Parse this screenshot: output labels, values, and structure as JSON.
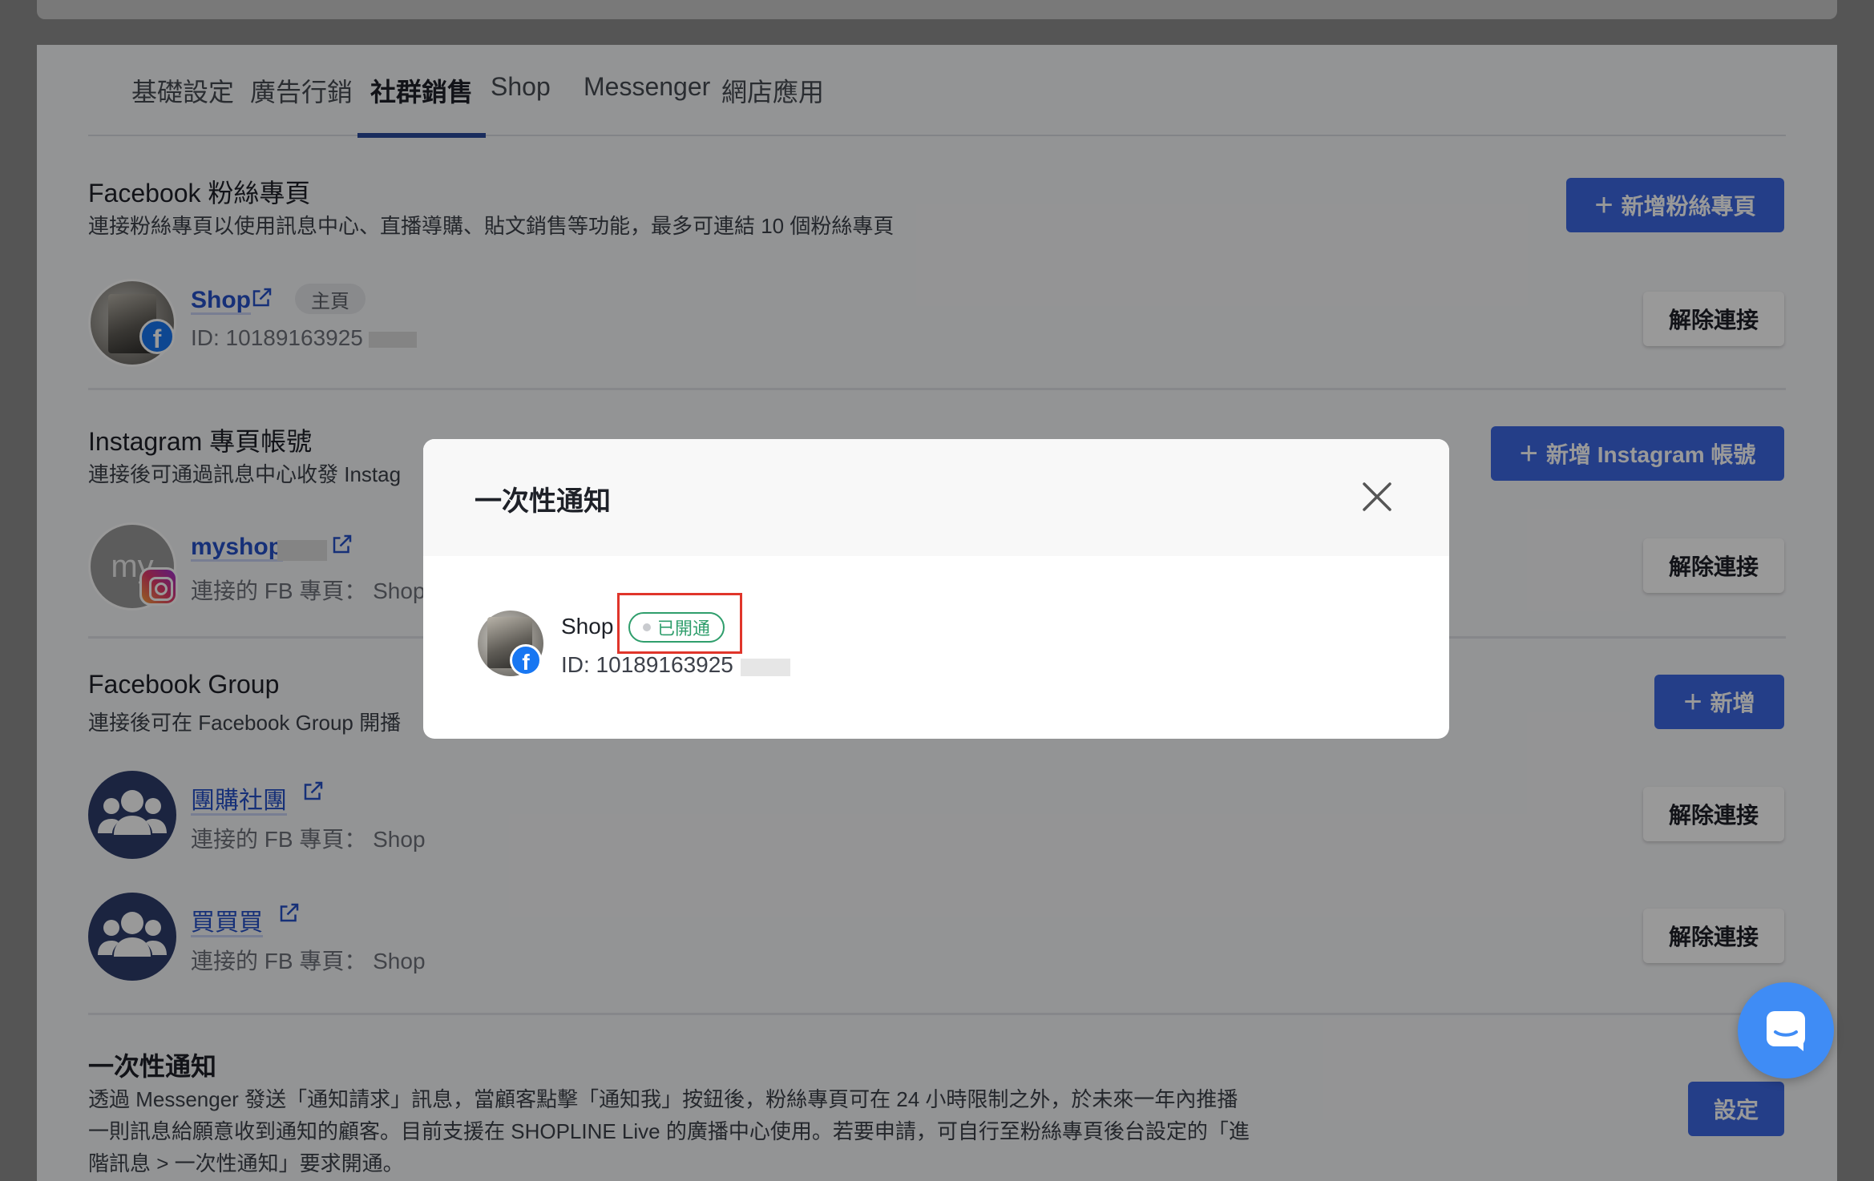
{
  "tabs": [
    "基礎設定",
    "廣告行銷",
    "社群銷售",
    "Shop",
    "Messenger",
    "網店應用"
  ],
  "facebook_pages": {
    "title": "Facebook 粉絲專頁",
    "desc": "連接粉絲專頁以使用訊息中心、直播導購、貼文銷售等功能，最多可連結 10 個粉絲專頁",
    "add_label": "新增粉絲專頁",
    "page_name": "Shop",
    "badge": "主頁",
    "id_text": "ID: 10189163925",
    "disconnect_label": "解除連接"
  },
  "instagram": {
    "title": "Instagram 專頁帳號",
    "desc": "連接後可通過訊息中心收發 Instag",
    "add_label": "新增 Instagram 帳號",
    "avatar_text": "my",
    "account_name": "myshop",
    "linked_text": "連接的 FB 專頁： Shop",
    "disconnect_label": "解除連接"
  },
  "facebook_group": {
    "title": "Facebook Group",
    "desc": "連接後可在 Facebook Group 開播",
    "add_label": "新增",
    "groups": [
      {
        "name": "團購社團",
        "linked_text": "連接的 FB 專頁： Shop",
        "disconnect_label": "解除連接"
      },
      {
        "name": "買買買",
        "linked_text": "連接的 FB 專頁： Shop",
        "disconnect_label": "解除連接"
      }
    ]
  },
  "one_time_notification": {
    "title": "一次性通知",
    "desc_line1": "透過 Messenger 發送「通知請求」訊息，當顧客點擊「通知我」按鈕後，粉絲專頁可在 24 小時限制之外，於未來一年內推播",
    "desc_line2": "一則訊息給願意收到通知的顧客。目前支援在 SHOPLINE Live 的廣播中心使用。若要申請，可自行至粉絲專頁後台設定的「進",
    "desc_line3": "階訊息 > 一次性通知」要求開通。",
    "settings_label": "設定"
  },
  "modal": {
    "title": "一次性通知",
    "page_name": "Shop",
    "status": "已開通",
    "id_text": "ID: 10189163925"
  },
  "colors": {
    "primary": "#3c68e3",
    "link": "#2650c9",
    "tab_indicator": "#2b4a9c",
    "status_green": "#2f9e6c",
    "highlight_red": "#e0352b",
    "chat_blue": "#3f8cf5"
  },
  "icons": [
    "external-link-icon",
    "facebook-icon",
    "instagram-icon",
    "group-icon",
    "close-icon",
    "chat-icon",
    "plus-icon"
  ]
}
